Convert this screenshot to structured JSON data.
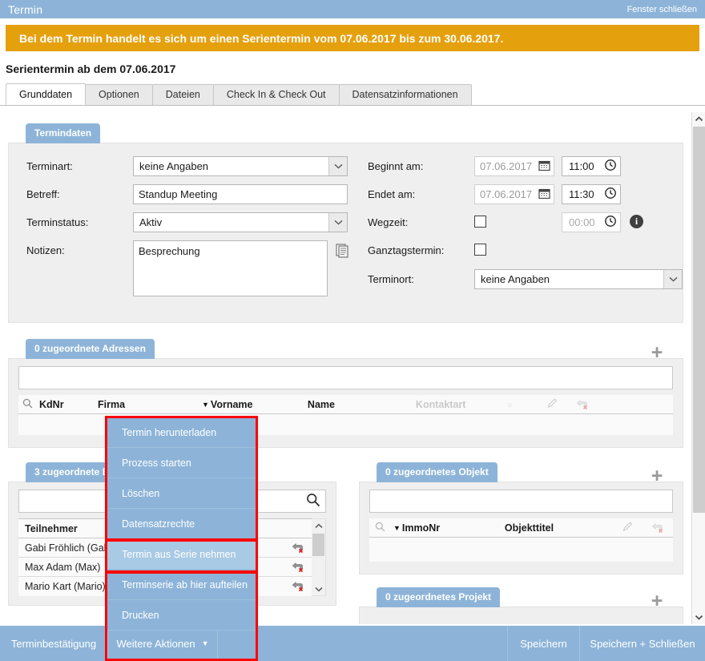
{
  "window": {
    "title": "Termin",
    "close_label": "Fenster schließen"
  },
  "banner": {
    "text": "Bei dem Termin handelt es sich um einen Serientermin vom 07.06.2017 bis zum 30.06.2017.",
    "color": "#e5a00d"
  },
  "page_title": "Serientermin ab dem 07.06.2017",
  "tabs": [
    {
      "label": "Grunddaten",
      "active": true
    },
    {
      "label": "Optionen",
      "active": false
    },
    {
      "label": "Dateien",
      "active": false
    },
    {
      "label": "Check In & Check Out",
      "active": false
    },
    {
      "label": "Datensatzinformationen",
      "active": false
    }
  ],
  "termindaten": {
    "panel_label": "Termindaten",
    "left": {
      "terminart_label": "Terminart:",
      "terminart_value": "keine Angaben",
      "betreff_label": "Betreff:",
      "betreff_value": "Standup Meeting",
      "terminstatus_label": "Terminstatus:",
      "terminstatus_value": "Aktiv",
      "notizen_label": "Notizen:",
      "notizen_value": "Besprechung"
    },
    "right": {
      "beginnt_label": "Beginnt am:",
      "beginnt_date": "07.06.2017",
      "beginnt_time": "11:00",
      "endet_label": "Endet am:",
      "endet_date": "07.06.2017",
      "endet_time": "11:30",
      "wegzeit_label": "Wegzeit:",
      "wegzeit_time": "00:00",
      "ganztag_label": "Ganztagstermin:",
      "terminort_label": "Terminort:",
      "terminort_value": "keine Angaben"
    }
  },
  "adressen": {
    "panel_label": "0 zugeordnete Adressen",
    "search_value": "",
    "columns": [
      "KdNr",
      "Firma",
      "Vorname",
      "Name",
      "Kontaktart"
    ],
    "rows": []
  },
  "beteiligte": {
    "panel_label": "3 zugeordnete B",
    "search_value": "",
    "column": "Teilnehmer",
    "rows": [
      "Gabi Fröhlich (Gabi)",
      "Max Adam (Max)",
      "Mario Kart (Mario)"
    ]
  },
  "objekt": {
    "panel_label": "0 zugeordnetes Objekt",
    "search_value": "",
    "columns": [
      "ImmoNr",
      "Objekttitel"
    ],
    "rows": []
  },
  "projekt": {
    "panel_label": "0 zugeordnetes Projekt"
  },
  "context_menu": {
    "items": [
      {
        "label": "Termin herunterladen",
        "highlighted": false
      },
      {
        "label": "Prozess starten",
        "highlighted": false
      },
      {
        "label": "Löschen",
        "highlighted": false
      },
      {
        "label": "Datensatzrechte",
        "highlighted": false
      },
      {
        "label": "Termin aus Serie nehmen",
        "highlighted": true
      },
      {
        "label": "Terminserie ab hier aufteilen",
        "highlighted": false
      },
      {
        "label": "Drucken",
        "highlighted": false
      }
    ],
    "highlight_color": "#ff0000"
  },
  "footer": {
    "terminbestaetigung": "Terminbestätigung",
    "weitere_aktionen": "Weitere Aktionen",
    "speichern": "Speichern",
    "speichern_schliessen": "Speichern + Schließen"
  }
}
